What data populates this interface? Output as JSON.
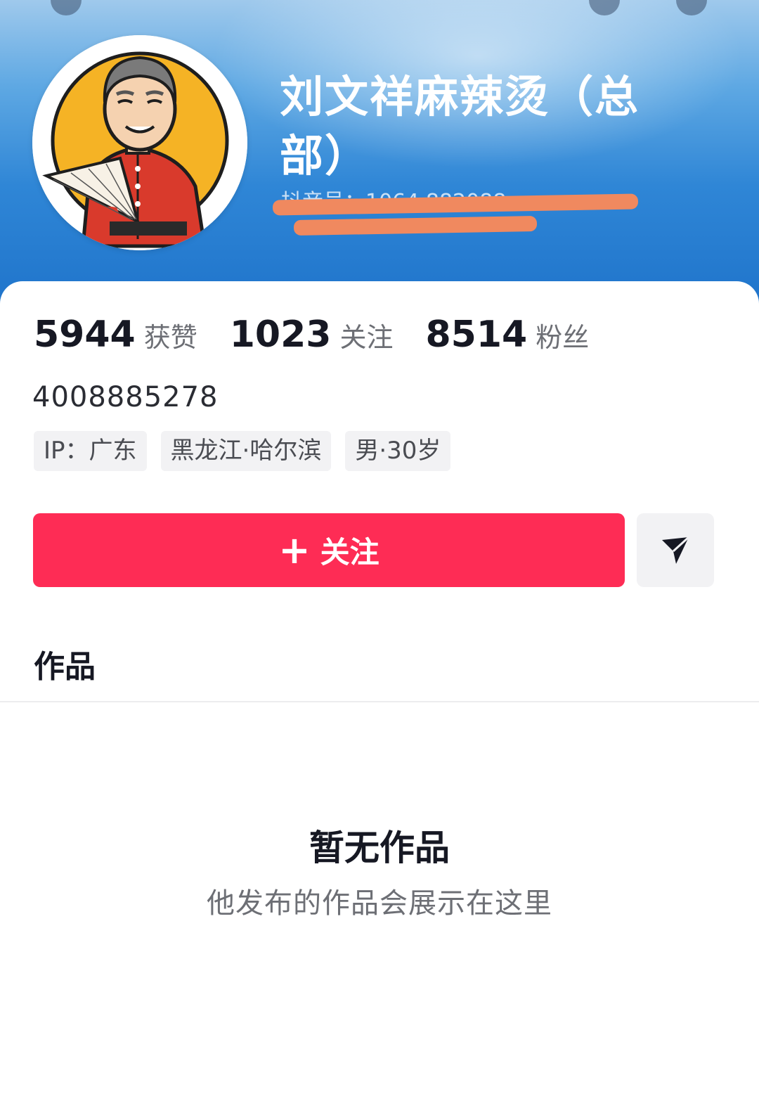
{
  "profile": {
    "name": "刘文祥麻辣烫（总部）",
    "douyin_id": "抖音号：1064 882088"
  },
  "stats": [
    {
      "value": "5944",
      "label": "获赞"
    },
    {
      "value": "1023",
      "label": "关注"
    },
    {
      "value": "8514",
      "label": "粉丝"
    }
  ],
  "bio": {
    "phone": "4008885278"
  },
  "tags": [
    "IP：广东",
    "黑龙江·哈尔滨",
    "男·30岁"
  ],
  "actions": {
    "follow_plus": "+",
    "follow_label": "关注",
    "message_icon": "send-icon"
  },
  "tabs": {
    "works": "作品"
  },
  "empty_state": {
    "title": "暂无作品",
    "subtitle": "他发布的作品会展示在这里"
  },
  "colors": {
    "accent": "#fe2c55",
    "header_blue": "#2f86d6",
    "redaction": "#f0895f"
  }
}
